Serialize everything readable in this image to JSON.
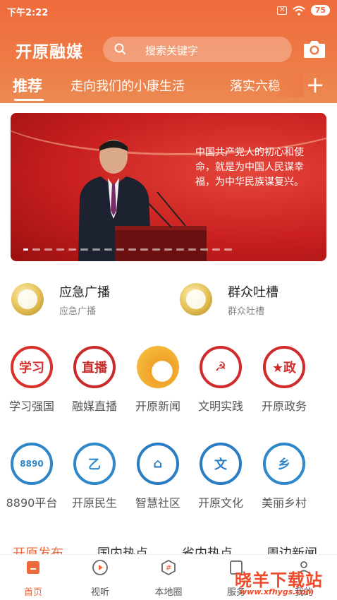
{
  "status": {
    "time": "下午2:22",
    "battery": "75"
  },
  "header": {
    "logo": "开原融媒",
    "search_placeholder": "搜索关键字"
  },
  "tabs": [
    {
      "label": "推荐",
      "active": true
    },
    {
      "label": "走向我们的小康生活",
      "active": false
    },
    {
      "label": "落实六稳",
      "active": false
    }
  ],
  "banner": {
    "text": "中国共产党人的初心和使命，就是为中国人民谋幸福，为中华民族谋复兴。",
    "slide_count": 18,
    "active_index": 0
  },
  "quick_links": [
    {
      "title": "应急广播",
      "subtitle": "应急广播"
    },
    {
      "title": "群众吐槽",
      "subtitle": "群众吐槽"
    }
  ],
  "services": [
    {
      "label": "学习强国",
      "icon": "xuexi-icon",
      "color": "#d9302c"
    },
    {
      "label": "融媒直播",
      "icon": "live-camera-icon",
      "color": "#c92b2b"
    },
    {
      "label": "开原新闻",
      "icon": "news-swirl-icon",
      "color": "#f1a22a"
    },
    {
      "label": "文明实践",
      "icon": "civic-emblem-icon",
      "color": "#d12a2a"
    },
    {
      "label": "开原政务",
      "icon": "star-gov-icon",
      "color": "#d02b2b"
    },
    {
      "label": "8890平台",
      "icon": "hotline-8890-icon",
      "color": "#2e86c8"
    },
    {
      "label": "开原民生",
      "icon": "minsheng-icon",
      "color": "#2e88c9"
    },
    {
      "label": "智慧社区",
      "icon": "house-icon",
      "color": "#2a7cc3"
    },
    {
      "label": "开原文化",
      "icon": "culture-icon",
      "color": "#2a7cc3"
    },
    {
      "label": "美丽乡村",
      "icon": "village-icon",
      "color": "#2e88c9"
    }
  ],
  "news_tabs": [
    "开原发布",
    "国内热点",
    "省内热点",
    "周边新闻"
  ],
  "bottom_nav": [
    {
      "label": "首页",
      "icon": "home-icon",
      "active": true
    },
    {
      "label": "视听",
      "icon": "play-icon",
      "active": false
    },
    {
      "label": "本地圈",
      "icon": "hashtag-icon",
      "active": false
    },
    {
      "label": "服务",
      "icon": "service-icon",
      "active": false
    },
    {
      "label": "我的",
      "icon": "profile-icon",
      "active": false
    }
  ],
  "watermark": {
    "title": "晓羊下载站",
    "url": "www.xfhygs.com"
  },
  "colors": {
    "brand": "#ee6a3a",
    "header_top": "#ef6a3c"
  }
}
